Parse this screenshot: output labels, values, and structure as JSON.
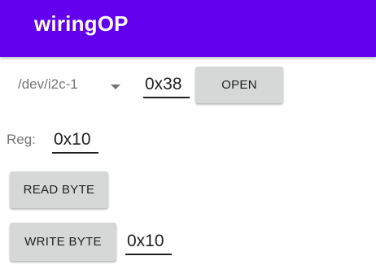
{
  "appbar": {
    "title": "wiringOP",
    "color": "#6200ee"
  },
  "i2c": {
    "device_selected": "/dev/i2c-1",
    "address_value": "0x38",
    "open_label": "OPEN"
  },
  "register": {
    "label": "Reg:",
    "value": "0x10"
  },
  "read": {
    "button_label": "READ BYTE"
  },
  "write": {
    "button_label": "WRITE BYTE",
    "value": "0x10"
  }
}
